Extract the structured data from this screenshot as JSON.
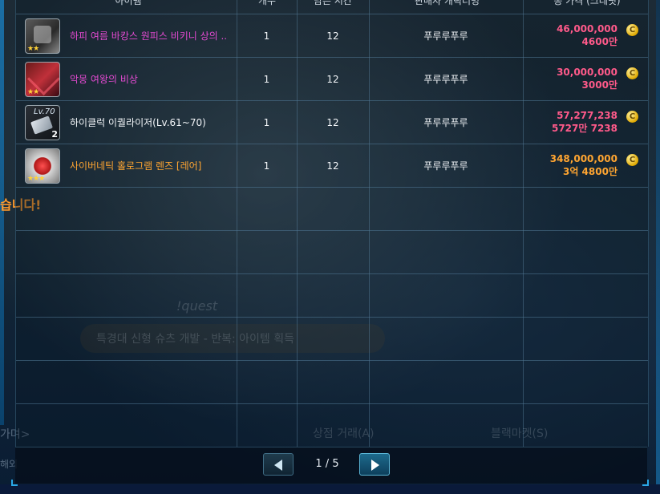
{
  "header": {
    "col_item": "아이템",
    "col_qty": "개수",
    "col_time": "남은 시간",
    "col_seller": "판매자 캐릭터명",
    "col_price": "총 가격 (크레딧)"
  },
  "listings": [
    {
      "icon": "swimsuit-item-icon",
      "stars": "★★",
      "count": "",
      "level_tag": "",
      "name": "하피 여름 바캉스 원피스 비키니 상의 ..",
      "name_color": "#e24ad0",
      "quantity": "1",
      "time_left": "12",
      "seller": "푸루루푸루",
      "price_main": "46,000,000",
      "price_sub": "4600만",
      "price_color": "#ff5a8a"
    },
    {
      "icon": "nightmare-queen-item-icon",
      "stars": "★★",
      "count": "",
      "level_tag": "",
      "name": "악몽 여왕의 비상",
      "name_color": "#e24ad0",
      "quantity": "1",
      "time_left": "12",
      "seller": "푸루루푸루",
      "price_main": "30,000,000",
      "price_sub": "3000만",
      "price_color": "#ff5a8a"
    },
    {
      "icon": "equalizer-item-icon",
      "stars": "",
      "count": "2",
      "level_tag": "Lv.70",
      "name": "하이클럭 이퀄라이저(Lv.61~70)",
      "name_color": "#f2f5f8",
      "quantity": "1",
      "time_left": "12",
      "seller": "푸루루푸루",
      "price_main": "57,277,238",
      "price_sub": "5727만 7238",
      "price_color": "#ff5a8a"
    },
    {
      "icon": "hologram-lens-item-icon",
      "stars": "★★★",
      "count": "",
      "level_tag": "",
      "name": "사이버네틱 홀로그램 렌즈 [레어]",
      "name_color": "#ffa531",
      "quantity": "1",
      "time_left": "12",
      "seller": "푸루루푸루",
      "price_main": "348,000,000",
      "price_sub": "3억 4800만",
      "price_color": "#ffa531"
    }
  ],
  "coin_symbol": "C",
  "background": {
    "quest_logo": "!quest",
    "quest_title": "특경대 신형 슈츠 개발 - 반복: 아이템 획득",
    "side_notice": "습니다!",
    "side_left_1": "가며>",
    "side_left_2": "해외",
    "btn_shop_trade": "상점 거래(A)",
    "btn_black_market": "블랙마켓(S)"
  },
  "pager": {
    "label": "1 / 5",
    "prev_icon": "arrow-left-icon",
    "next_icon": "arrow-right-icon"
  },
  "colors": {
    "accent": "#2aa8e8",
    "legendary_name": "#e24ad0",
    "rare_name": "#ffa531",
    "price_pink": "#ff5a8a"
  }
}
